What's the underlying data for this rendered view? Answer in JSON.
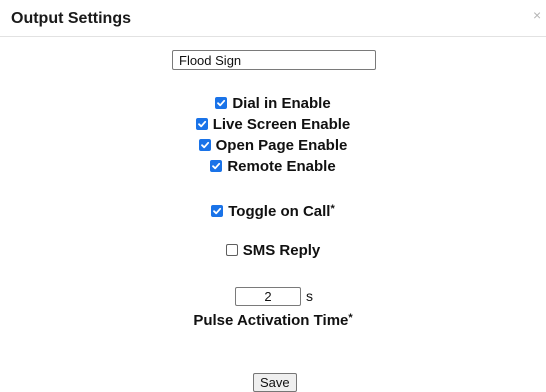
{
  "dialog": {
    "title": "Output Settings",
    "close_glyph": "×",
    "close_icon": "close-icon"
  },
  "output_name": {
    "value": "Flood Sign"
  },
  "options": {
    "dial_in": {
      "label": "Dial in Enable",
      "checked": true
    },
    "live_screen": {
      "label": "Live Screen Enable",
      "checked": true
    },
    "open_page": {
      "label": "Open Page Enable",
      "checked": true
    },
    "remote": {
      "label": "Remote Enable",
      "checked": true
    },
    "toggle_on_call": {
      "label": "Toggle on Call",
      "required_mark": "*",
      "checked": true
    },
    "sms_reply": {
      "label": "SMS Reply",
      "checked": false
    }
  },
  "pulse": {
    "value": "2",
    "unit": "s",
    "label": "Pulse Activation Time",
    "required_mark": "*"
  },
  "actions": {
    "save_label": "Save"
  },
  "colors": {
    "checkbox_accent": "#1a73e8",
    "divider": "#e2e2e2"
  }
}
